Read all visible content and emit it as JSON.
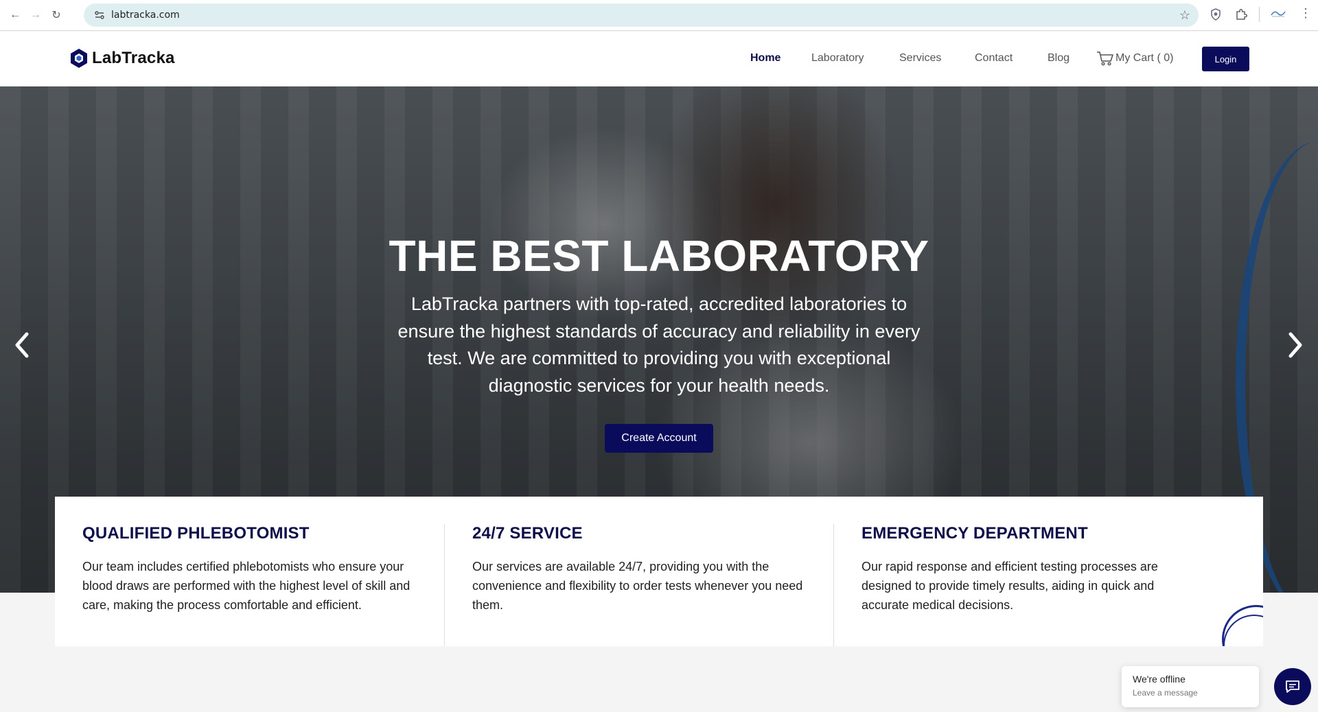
{
  "browser": {
    "url": "labtracka.com",
    "back_icon": "arrow-left-icon",
    "forward_icon": "arrow-right-icon",
    "reload_icon": "reload-icon"
  },
  "header": {
    "logo_text": "LabTracka",
    "nav": [
      {
        "label": "Home",
        "active": true
      },
      {
        "label": "Laboratory",
        "active": false
      },
      {
        "label": "Services",
        "active": false
      },
      {
        "label": "Contact",
        "active": false
      },
      {
        "label": "Blog",
        "active": false
      }
    ],
    "cart_label": "My Cart ( 0)",
    "login_label": "Login"
  },
  "hero": {
    "title": "THE BEST LABORATORY",
    "text": "LabTracka partners with top-rated, accredited laboratories to ensure the highest standards of accuracy and reliability in every test. We are committed to providing you with exceptional diagnostic services for your health needs.",
    "cta_label": "Create Account",
    "prev_glyph": "‹",
    "next_glyph": "›"
  },
  "features": [
    {
      "title": "QUALIFIED PHLEBOTOMIST",
      "text": "Our team includes certified phlebotomists who ensure your blood draws are performed with the highest level of skill and care, making the process comfortable and efficient."
    },
    {
      "title": "24/7 SERVICE",
      "text": "Our services are available 24/7, providing you with the convenience and flexibility to order tests whenever you need them."
    },
    {
      "title": "EMERGENCY DEPARTMENT",
      "text": "Our rapid response and efficient testing processes are designed to provide timely results, aiding in quick and accurate medical decisions."
    }
  ],
  "chat": {
    "status": "We're offline",
    "subtext": "Leave a message"
  },
  "colors": {
    "brand_navy": "#0b0b5c",
    "heading_navy": "#0d0d4a",
    "accent_blue": "#1b5fb0"
  }
}
